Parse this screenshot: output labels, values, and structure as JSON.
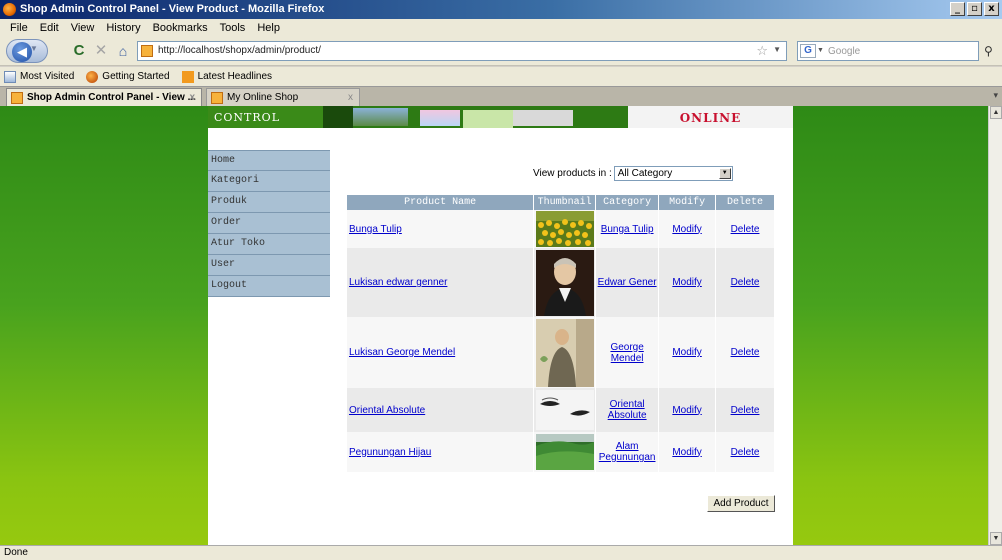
{
  "window": {
    "title": "Shop Admin Control Panel - View Product - Mozilla Firefox",
    "buttons": [
      "_",
      "▫",
      "x"
    ]
  },
  "menu": [
    "File",
    "Edit",
    "View",
    "History",
    "Bookmarks",
    "Tools",
    "Help"
  ],
  "navbar": {
    "url": "http://localhost/shopx/admin/product/",
    "search_placeholder": "Google"
  },
  "bookmarks": [
    "Most Visited",
    "Getting Started",
    "Latest Headlines"
  ],
  "tabs": [
    {
      "label": "Shop Admin Control Panel - View ...",
      "close": "x"
    },
    {
      "label": "My Online Shop",
      "close": "x"
    }
  ],
  "banner": {
    "control_panel": "CONTROL PANEL",
    "online": "ONLINE"
  },
  "sidebar": {
    "items": [
      "Home",
      "Kategori",
      "Produk",
      "Order",
      "Atur Toko",
      "User",
      "Logout"
    ]
  },
  "filter": {
    "label": "View products in :",
    "selected": "All Category"
  },
  "table": {
    "headers": [
      "Product Name",
      "Thumbnail",
      "Category",
      "Modify",
      "Delete"
    ],
    "modify_label": "Modify",
    "delete_label": "Delete",
    "rows": [
      {
        "name": "Bunga Tulip",
        "category": "Bunga Tulip",
        "thumb": "tulip-field"
      },
      {
        "name": "Lukisan edwar genner",
        "category": "Edwar Gener",
        "thumb": "portrait-man"
      },
      {
        "name": "Lukisan George Mendel",
        "category": "George Mendel",
        "thumb": "portrait-mendel"
      },
      {
        "name": "Oriental Absolute",
        "category": "Oriental Absolute",
        "thumb": "eyes"
      },
      {
        "name": "Pegunungan Hijau",
        "category": "Alam Pegunungan",
        "thumb": "green-hills"
      }
    ]
  },
  "add_button": "Add Product",
  "status": "Done",
  "colors": {
    "page_bg_top": "#2e8a16",
    "page_bg_bottom": "#96c90f",
    "sidebar_bg": "#a9c0d3",
    "table_header": "#8fa7bd",
    "link": "#0000cc",
    "online_text": "#c8102e"
  }
}
